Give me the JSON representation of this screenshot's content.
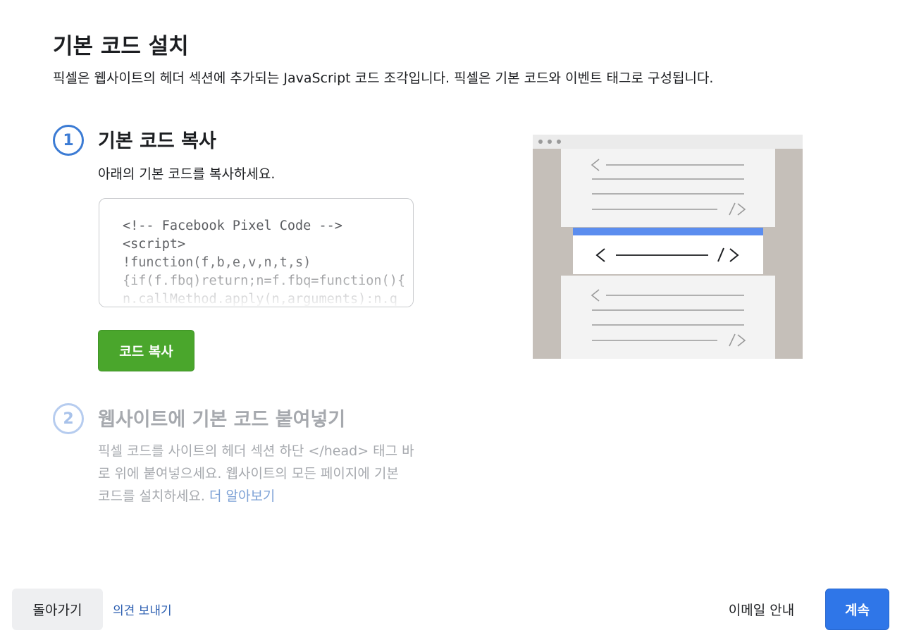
{
  "header": {
    "title": "기본 코드 설치",
    "description": "픽셀은 웹사이트의 헤더 섹션에 추가되는 JavaScript 코드 조각입니다. 픽셀은 기본 코드와 이벤트 태그로 구성됩니다."
  },
  "step1": {
    "number": "1",
    "title": "기본 코드 복사",
    "description": "아래의 기본 코드를 복사하세요.",
    "code_lines": [
      "<!-- Facebook Pixel Code -->",
      "<script>",
      "!function(f,b,e,v,n,t,s)",
      "{if(f.fbq)return;n=f.fbq=function(){",
      "n.callMethod.apply(n,arguments):n.q"
    ],
    "copy_button_label": "코드 복사"
  },
  "step2": {
    "number": "2",
    "title": "웹사이트에 기본 코드 붙여넣기",
    "description": "픽셀 코드를 사이트의 헤더 섹션 하단 </head> 태그 바로 위에 붙여넣으세요. 웹사이트의 모든 페이지에 기본 코드를 설치하세요.",
    "learn_more": "더 알아보기"
  },
  "footer": {
    "back_label": "돌아가기",
    "feedback_label": "의견 보내기",
    "email_label": "이메일 안내",
    "continue_label": "계속"
  },
  "colors": {
    "accent_blue": "#2f76e8",
    "copy_green": "#4aa62c",
    "highlight_bar": "#5b8def"
  }
}
